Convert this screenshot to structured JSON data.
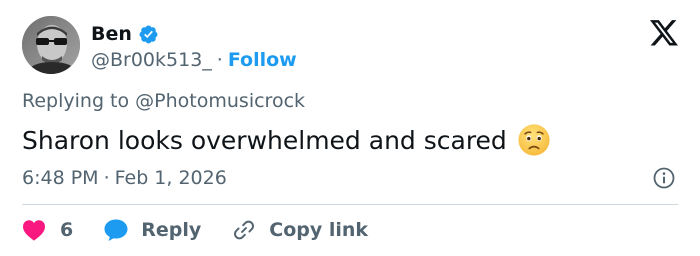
{
  "author": {
    "name": "Ben",
    "handle": "@Br00k513_",
    "separator": "·",
    "follow_label": "Follow"
  },
  "reply_context": {
    "prefix": "Replying to",
    "mention": "@Photomusicrock"
  },
  "tweet": {
    "text": "Sharon looks overwhelmed and scared",
    "emoji": "anxious-face-emoji",
    "time": "6:48 PM",
    "separator": "·",
    "date": "Feb 1, 2026"
  },
  "actions": {
    "like_count": "6",
    "reply_label": "Reply",
    "copy_label": "Copy link"
  },
  "colors": {
    "text": "#0f1419",
    "secondary": "#536471",
    "accent": "#1d9bf0",
    "like": "#f91880",
    "divider": "#cfd9de"
  },
  "icons": {
    "verified": "verified-badge-icon",
    "logo": "x-logo-icon",
    "info": "info-icon",
    "like": "heart-icon",
    "reply": "speech-bubble-icon",
    "copy": "link-icon"
  }
}
